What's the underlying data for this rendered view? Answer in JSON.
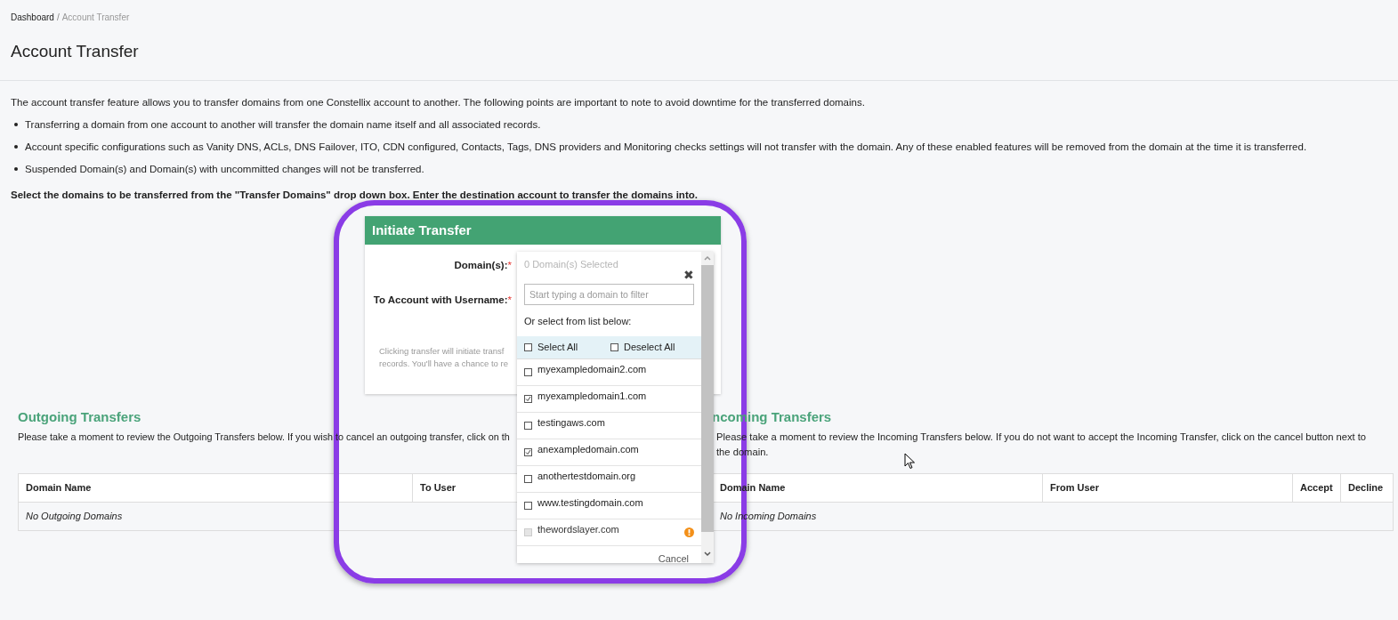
{
  "breadcrumb": {
    "items": [
      {
        "label": "Dashboard",
        "selected": false
      },
      {
        "label": "Account Transfer",
        "selected": true
      }
    ],
    "separator": "/"
  },
  "title": "Account Transfer",
  "intro": "The account transfer feature allows you to transfer domains from one Constellix account to another. The following points are important to note to avoid downtime for the transferred domains.",
  "bullets": [
    "Transferring a domain from one account to another will transfer the domain name itself and all associated records.",
    "Account specific configurations such as Vanity DNS, ACLs, DNS Failover, ITO, CDN configured, Contacts, Tags, DNS providers and Monitoring checks settings will not transfer with the domain. Any of these enabled features will be removed from the domain at the time it is transferred.",
    "Suspended Domain(s) and Domain(s) with uncommitted changes will not be transferred."
  ],
  "instruction": "Select the domains to be transferred from the \"Transfer Domains\" drop down box. Enter the destination account to transfer the domains into.",
  "initiate_transfer": {
    "title": "Initiate Transfer",
    "fields": [
      {
        "label": "Domain(s):",
        "required": true
      },
      {
        "label": "To Account with Username:",
        "required": true
      }
    ],
    "required_mark": "*",
    "note_lines": [
      "Clicking transfer will initiate transf",
      "records. You'll have a chance to re"
    ]
  },
  "domain_picker": {
    "summary": "0 Domain(s) Selected",
    "close": "✖",
    "filter": {
      "placeholder": "Start typing a domain to filter"
    },
    "prompt": "Or select from list below:",
    "select_all": {
      "label": "Select All",
      "checked": false
    },
    "deselect_all": {
      "label": "Deselect All",
      "checked": false
    },
    "domains": [
      {
        "name": "myexampledomain2.com",
        "checked": false,
        "disabled": false,
        "warning": false
      },
      {
        "name": "myexampledomain1.com",
        "checked": true,
        "disabled": false,
        "warning": false
      },
      {
        "name": "testingaws.com",
        "checked": false,
        "disabled": false,
        "warning": false
      },
      {
        "name": "anexampledomain.com",
        "checked": true,
        "disabled": false,
        "warning": false
      },
      {
        "name": "anothertestdomain.org",
        "checked": false,
        "disabled": false,
        "warning": false
      },
      {
        "name": "www.testingdomain.com",
        "checked": false,
        "disabled": false,
        "warning": false
      },
      {
        "name": "thewordslayer.com",
        "checked": false,
        "disabled": true,
        "warning": true
      }
    ],
    "cancel": "Cancel"
  },
  "outgoing": {
    "title": "Outgoing Transfers",
    "description": "Please take a moment to review the Outgoing Transfers below. If you wish to cancel an outgoing transfer, click on th",
    "columns": [
      "Domain Name",
      "To User"
    ],
    "empty": "No Outgoing Domains"
  },
  "incoming": {
    "title": "ncoming Transfers",
    "description": "Please take a moment to review the Incoming Transfers below. If you do not want to accept the Incoming Transfer, click on the cancel button next to the domain.",
    "columns": [
      "Domain Name",
      "From User",
      "Accept",
      "Decline"
    ],
    "empty": "No Incoming Domains"
  }
}
